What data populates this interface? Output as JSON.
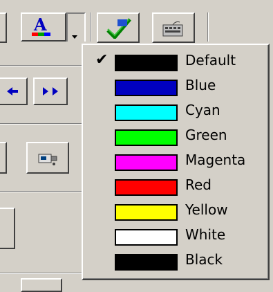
{
  "menu": {
    "items": [
      {
        "label": "Default",
        "color": "#000000",
        "checked": true
      },
      {
        "label": "Blue",
        "color": "#0000c0",
        "checked": false
      },
      {
        "label": "Cyan",
        "color": "#00ffff",
        "checked": false
      },
      {
        "label": "Green",
        "color": "#00ff00",
        "checked": false
      },
      {
        "label": "Magenta",
        "color": "#ff00ff",
        "checked": false
      },
      {
        "label": "Red",
        "color": "#ff0000",
        "checked": false
      },
      {
        "label": "Yellow",
        "color": "#ffff00",
        "checked": false
      },
      {
        "label": "White",
        "color": "#ffffff",
        "checked": false
      },
      {
        "label": "Black",
        "color": "#000000",
        "checked": false
      }
    ],
    "check_glyph": "✔"
  },
  "toolbar": {
    "text_color_icon": "text-color-icon",
    "dropdown_arrow_icon": "dropdown-arrow-icon",
    "check_icon": "green-check-icon",
    "keyboard_icon": "keyboard-icon",
    "nav_left_icon": "navigate-back-icon",
    "nav_right_icon": "navigate-forward-icon",
    "tool_icon": "device-icon"
  }
}
